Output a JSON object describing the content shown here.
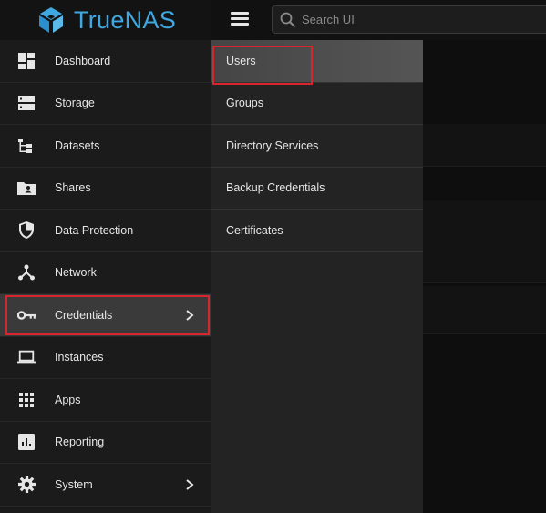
{
  "app": {
    "brand_name": "TrueNAS",
    "brand_color": "#3fa8e0"
  },
  "search": {
    "placeholder": "Search UI"
  },
  "sidebar": {
    "items": [
      {
        "label": "Dashboard",
        "icon": "dashboard-icon"
      },
      {
        "label": "Storage",
        "icon": "storage-icon"
      },
      {
        "label": "Datasets",
        "icon": "datasets-icon"
      },
      {
        "label": "Shares",
        "icon": "shares-icon"
      },
      {
        "label": "Data Protection",
        "icon": "shield-icon"
      },
      {
        "label": "Network",
        "icon": "network-icon"
      },
      {
        "label": "Credentials",
        "icon": "key-icon",
        "active": true,
        "has_submenu": true
      },
      {
        "label": "Instances",
        "icon": "laptop-icon"
      },
      {
        "label": "Apps",
        "icon": "apps-grid-icon"
      },
      {
        "label": "Reporting",
        "icon": "reporting-icon"
      },
      {
        "label": "System",
        "icon": "gear-icon",
        "has_submenu": true
      }
    ]
  },
  "submenu": {
    "items": [
      {
        "label": "Users",
        "highlighted": true
      },
      {
        "label": "Groups"
      },
      {
        "label": "Directory Services"
      },
      {
        "label": "Backup Credentials"
      },
      {
        "label": "Certificates"
      }
    ]
  },
  "colors": {
    "highlight_border": "#d9262e",
    "sidebar_bg": "#1b1b1b",
    "submenu_bg": "#232323"
  }
}
